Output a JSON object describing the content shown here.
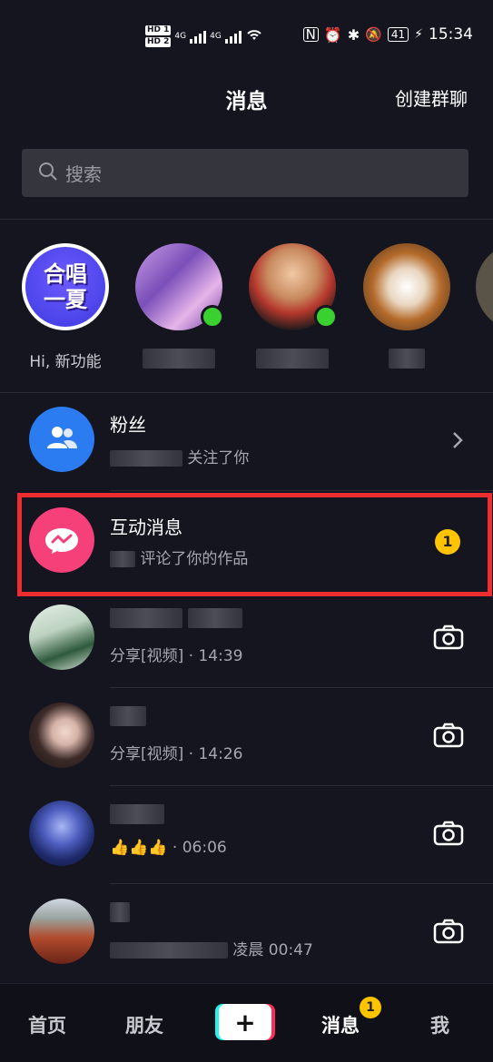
{
  "status_bar": {
    "sim1": "HD 1",
    "sim2": "HD 2",
    "net1": "4G",
    "net2": "4G",
    "battery": "41",
    "time": "15:34"
  },
  "header": {
    "title": "消息",
    "create_group": "创建群聊"
  },
  "search": {
    "placeholder": "搜索"
  },
  "stories": [
    {
      "avatar_text": "合唱\n一夏",
      "label": "Hi, 新功能",
      "online": false
    },
    {
      "label": "",
      "online": true
    },
    {
      "label": "",
      "online": true
    },
    {
      "label": "",
      "online": false
    }
  ],
  "rows": {
    "fans": {
      "name": "粉丝",
      "sub": "关注了你"
    },
    "interactions": {
      "name": "互动消息",
      "sub": "评论了你的作品",
      "badge": "1"
    },
    "chat1": {
      "sub": "分享[视频] · 14:39"
    },
    "chat2": {
      "sub": "分享[视频] · 14:26"
    },
    "chat3": {
      "sub_emoji": "👍👍👍",
      "sub_time": " · 06:06"
    },
    "chat4": {
      "sub": "凌晨 00:47"
    }
  },
  "tabbar": {
    "home": "首页",
    "friends": "朋友",
    "plus": "+",
    "messages": "消息",
    "messages_badge": "1",
    "me": "我"
  },
  "colors": {
    "background": "#15151f",
    "highlight": "#ee2d31",
    "badge": "#ffc300",
    "online": "#38d12f"
  }
}
